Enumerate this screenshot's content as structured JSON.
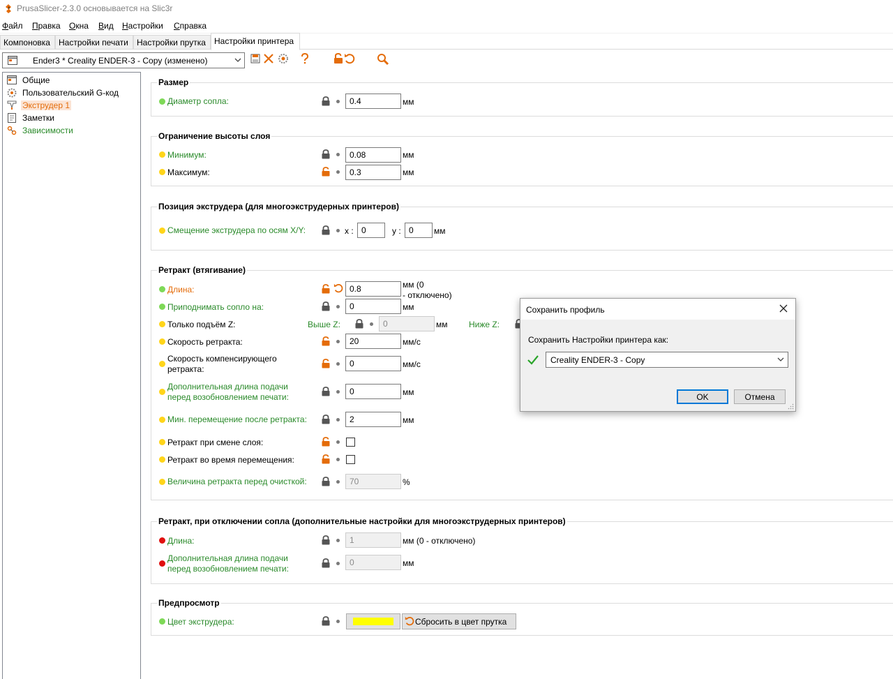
{
  "window": {
    "title": "PrusaSlicer-2.3.0 основывается на Slic3r"
  },
  "menu": [
    {
      "pre": "",
      "u": "Ф",
      "post": "айл"
    },
    {
      "pre": "",
      "u": "П",
      "post": "равка"
    },
    {
      "pre": "",
      "u": "О",
      "post": "кна"
    },
    {
      "pre": "",
      "u": "В",
      "post": "ид"
    },
    {
      "pre": "",
      "u": "Н",
      "post": "астройки"
    },
    {
      "pre": "",
      "u": "С",
      "post": "правка"
    }
  ],
  "tabs": [
    "Компоновка",
    "Настройки печати",
    "Настройки прутка",
    "Настройки принтера"
  ],
  "preset": {
    "value": "Ender3 * Creality ENDER-3 - Copy (изменено)"
  },
  "sidebar": {
    "items": [
      "Общие",
      "Пользовательский G-код",
      "Экструдер 1",
      "Заметки",
      "Зависимости"
    ]
  },
  "groups": {
    "size": {
      "title": "Размер",
      "nozzle_label": "Диаметр сопла:",
      "nozzle_value": "0.4",
      "nozzle_unit": "мм"
    },
    "layer_height": {
      "title": "Ограничение высоты слоя",
      "min_label": "Минимум:",
      "min_value": "0.08",
      "min_unit": "мм",
      "max_label": "Максимум:",
      "max_value": "0.3",
      "max_unit": "мм"
    },
    "offset": {
      "title": "Позиция экструдера (для многоэкструдерных принтеров)",
      "label": "Смещение экструдера по осям X/Y:",
      "x_label": "x :",
      "x_value": "0",
      "y_label": "y :",
      "y_value": "0",
      "unit": "мм"
    },
    "retract": {
      "title": "Ретракт (втягивание)",
      "length_label": "Длина:",
      "length_value": "0.8",
      "length_unit_1": "мм (0",
      "length_unit_2": "- отключено)",
      "lift_label": "Приподнимать сопло на:",
      "lift_value": "0",
      "lift_unit": "мм",
      "only_lift_label": "Только подъём Z:",
      "above_z_label": "Выше Z:",
      "above_z_value": "0",
      "above_z_unit": "мм",
      "below_z_label": "Ниже Z:",
      "speed_label": "Скорость ретракта:",
      "speed_value": "20",
      "speed_unit": "мм/с",
      "deretract_label_1": "Скорость компенсирующего",
      "deretract_label_2": "ретракта:",
      "deretract_value": "0",
      "deretract_unit": "мм/с",
      "extra_label_1": "Дополнительная длина подачи",
      "extra_label_2": "перед возобновлением печати:",
      "extra_value": "0",
      "extra_unit": "мм",
      "min_travel_label": "Мин. перемещение после ретракта:",
      "min_travel_value": "2",
      "min_travel_unit": "мм",
      "layer_change_label": "Ретракт при смене слоя:",
      "wipe_label": "Ретракт во время перемещения:",
      "before_wipe_label": "Величина ретракта перед очисткой:",
      "before_wipe_value": "70",
      "before_wipe_unit": "%"
    },
    "toolchange": {
      "title": "Ретракт, при отключении сопла (дополнительные настройки для многоэкструдерных принтеров)",
      "length_label": "Длина:",
      "length_value": "1",
      "length_unit": "мм (0 - отключено)",
      "extra_label_1": "Дополнительная длина подачи",
      "extra_label_2": "перед возобновлением печати:",
      "extra_value": "0",
      "extra_unit": "мм"
    },
    "preview": {
      "title": "Предпросмотр",
      "color_label": "Цвет экструдера:",
      "color_value": "#ffff00",
      "reset_label": "Сбросить в цвет прутка"
    }
  },
  "dialog": {
    "title": "Сохранить профиль",
    "prompt": "Сохранить Настройки принтера как:",
    "name_value": "Creality ENDER-3 - Copy",
    "ok_label": "OK",
    "cancel_label": "Отмена"
  },
  "colors": {
    "accent_orange": "#e46c0a",
    "modified_green": "#2a8a2a",
    "dialog_ok_border": "#0078d7"
  },
  "icons": [
    "prusa-logo-icon",
    "printer-icon",
    "save-icon",
    "delete-icon",
    "compare-icon",
    "help-icon",
    "unlock-icon",
    "undo-icon",
    "search-icon",
    "lock-icon",
    "close-icon",
    "checkmark-icon",
    "chevron-down-icon",
    "gear-icon",
    "extruder-icon",
    "notes-icon",
    "dependencies-icon"
  ]
}
